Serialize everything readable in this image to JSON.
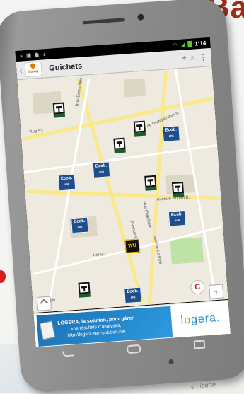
{
  "background": {
    "heading_fragment": "Ba",
    "street_fragment": "e Liberté"
  },
  "statusbar": {
    "time": "1:14"
  },
  "appbar": {
    "back_label": "‹",
    "logo_text": "banky",
    "title": "Guichets",
    "actions": [
      "location-pin-icon",
      "search-icon",
      "overflow-menu-icon"
    ]
  },
  "map": {
    "streets": [
      "Rue Dominique",
      "Avenue Kennedy",
      "Rue de l'Indépendance",
      "Avenue Houari B.",
      "Rue Abdelkrim",
      "Avenue Lounès",
      "rue 50",
      "Rue 53",
      "Sidi"
    ],
    "markers": {
      "ecobank_label_top": "Ecob.",
      "ecobank_label_bottom": "ank",
      "western_union_label": "WU",
      "generic_label": "C"
    },
    "zoom_in": "+"
  },
  "ad": {
    "headline_line1": "LOGERA, la solution, pour gérer",
    "headline_line2": "vos résultats d'analyses,",
    "headline_line3": "http://logera.sen-solution.net",
    "brand_left": "l",
    "brand_g": "o",
    "brand_right": "gera",
    "brand_sup": "."
  },
  "colors": {
    "road": "#fbe88a",
    "ecobank": "#1f4e8c",
    "treasury_green": "#1a5b2f",
    "western_union": "#f2c500",
    "phone_body": "#8a8a8a"
  }
}
